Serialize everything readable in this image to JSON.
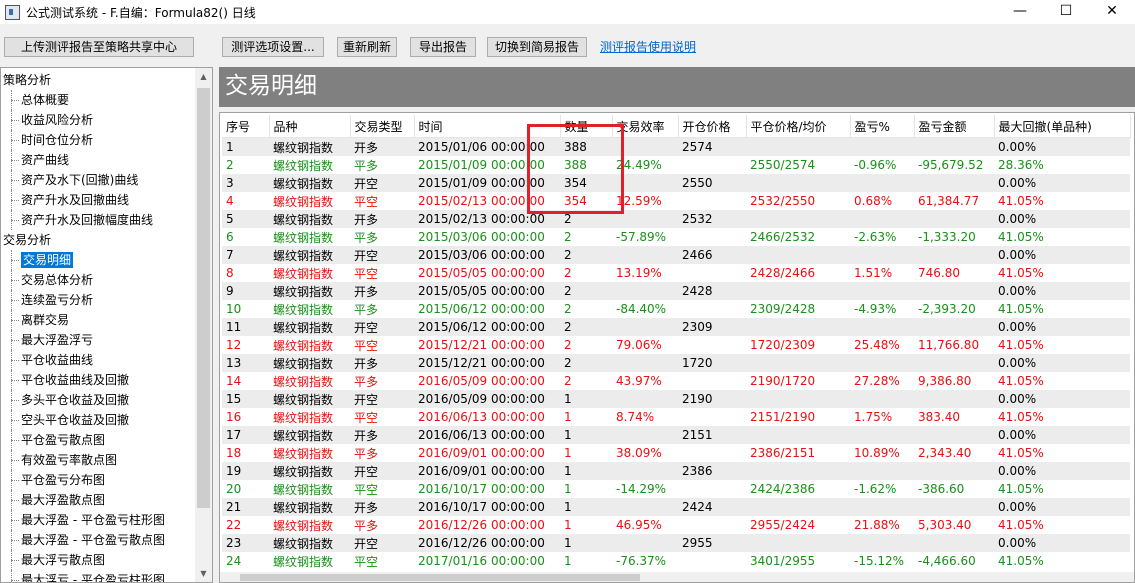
{
  "window": {
    "title": "公式测试系统 - F.自编：Formula82() 日线",
    "minimize": "—",
    "maximize": "☐",
    "close": "✕"
  },
  "toolbar": {
    "upload": "上传测评报告至策略共享中心",
    "options": "测评选项设置...",
    "refresh": "重新刷新",
    "export": "导出报告",
    "switch": "切换到简易报告",
    "help_link": "测评报告使用说明"
  },
  "sidebar": {
    "items": [
      {
        "label": "策略分析",
        "level": 0
      },
      {
        "label": "总体概要",
        "level": 1
      },
      {
        "label": "收益风险分析",
        "level": 1
      },
      {
        "label": "时间仓位分析",
        "level": 1
      },
      {
        "label": "资产曲线",
        "level": 1
      },
      {
        "label": "资产及水下(回撤)曲线",
        "level": 1
      },
      {
        "label": "资产升水及回撤曲线",
        "level": 1
      },
      {
        "label": "资产升水及回撤幅度曲线",
        "level": 1
      },
      {
        "label": "交易分析",
        "level": 0
      },
      {
        "label": "交易明细",
        "level": 1,
        "selected": true
      },
      {
        "label": "交易总体分析",
        "level": 1
      },
      {
        "label": "连续盈亏分析",
        "level": 1
      },
      {
        "label": "离群交易",
        "level": 1
      },
      {
        "label": "最大浮盈浮亏",
        "level": 1
      },
      {
        "label": "平仓收益曲线",
        "level": 1
      },
      {
        "label": "平仓收益曲线及回撤",
        "level": 1
      },
      {
        "label": "多头平仓收益及回撤",
        "level": 1
      },
      {
        "label": "空头平仓收益及回撤",
        "level": 1
      },
      {
        "label": "平仓盈亏散点图",
        "level": 1
      },
      {
        "label": "有效盈亏率散点图",
        "level": 1
      },
      {
        "label": "平仓盈亏分布图",
        "level": 1
      },
      {
        "label": "最大浮盈散点图",
        "level": 1
      },
      {
        "label": "最大浮盈 - 平仓盈亏柱形图",
        "level": 1
      },
      {
        "label": "最大浮盈 - 平仓盈亏散点图",
        "level": 1
      },
      {
        "label": "最大浮亏散点图",
        "level": 1
      },
      {
        "label": "最大浮亏 - 平仓盈亏柱形图",
        "level": 1
      }
    ]
  },
  "main": {
    "heading": "交易明细",
    "columns": [
      "序号",
      "品种",
      "交易类型",
      "时间",
      "数量",
      "交易效率",
      "开仓价格",
      "平仓价格/均价",
      "盈亏%",
      "盈亏金额",
      "最大回撤(单品种)"
    ],
    "rows": [
      {
        "color": "black",
        "cells": [
          "1",
          "螺纹钢指数",
          "开多",
          "2015/01/06 00:00:00",
          "388",
          "",
          "2574",
          "",
          "",
          "",
          "0.00%"
        ]
      },
      {
        "color": "green",
        "cells": [
          "2",
          "螺纹钢指数",
          "平多",
          "2015/01/09 00:00:00",
          "388",
          "24.49%",
          "",
          "2550/2574",
          "-0.96%",
          "-95,679.52",
          "28.36%"
        ]
      },
      {
        "color": "black",
        "cells": [
          "3",
          "螺纹钢指数",
          "开空",
          "2015/01/09 00:00:00",
          "354",
          "",
          "2550",
          "",
          "",
          "",
          "0.00%"
        ]
      },
      {
        "color": "red",
        "cells": [
          "4",
          "螺纹钢指数",
          "平空",
          "2015/02/13 00:00:00",
          "354",
          "12.59%",
          "",
          "2532/2550",
          "0.68%",
          "61,384.77",
          "41.05%"
        ]
      },
      {
        "color": "black",
        "cells": [
          "5",
          "螺纹钢指数",
          "开多",
          "2015/02/13 00:00:00",
          "2",
          "",
          "2532",
          "",
          "",
          "",
          "0.00%"
        ]
      },
      {
        "color": "green",
        "cells": [
          "6",
          "螺纹钢指数",
          "平多",
          "2015/03/06 00:00:00",
          "2",
          "-57.89%",
          "",
          "2466/2532",
          "-2.63%",
          "-1,333.20",
          "41.05%"
        ]
      },
      {
        "color": "black",
        "cells": [
          "7",
          "螺纹钢指数",
          "开空",
          "2015/03/06 00:00:00",
          "2",
          "",
          "2466",
          "",
          "",
          "",
          "0.00%"
        ]
      },
      {
        "color": "red",
        "cells": [
          "8",
          "螺纹钢指数",
          "平空",
          "2015/05/05 00:00:00",
          "2",
          "13.19%",
          "",
          "2428/2466",
          "1.51%",
          "746.80",
          "41.05%"
        ]
      },
      {
        "color": "black",
        "cells": [
          "9",
          "螺纹钢指数",
          "开多",
          "2015/05/05 00:00:00",
          "2",
          "",
          "2428",
          "",
          "",
          "",
          "0.00%"
        ]
      },
      {
        "color": "green",
        "cells": [
          "10",
          "螺纹钢指数",
          "平多",
          "2015/06/12 00:00:00",
          "2",
          "-84.40%",
          "",
          "2309/2428",
          "-4.93%",
          "-2,393.20",
          "41.05%"
        ]
      },
      {
        "color": "black",
        "cells": [
          "11",
          "螺纹钢指数",
          "开空",
          "2015/06/12 00:00:00",
          "2",
          "",
          "2309",
          "",
          "",
          "",
          "0.00%"
        ]
      },
      {
        "color": "red",
        "cells": [
          "12",
          "螺纹钢指数",
          "平空",
          "2015/12/21 00:00:00",
          "2",
          "79.06%",
          "",
          "1720/2309",
          "25.48%",
          "11,766.80",
          "41.05%"
        ]
      },
      {
        "color": "black",
        "cells": [
          "13",
          "螺纹钢指数",
          "开多",
          "2015/12/21 00:00:00",
          "2",
          "",
          "1720",
          "",
          "",
          "",
          "0.00%"
        ]
      },
      {
        "color": "red",
        "cells": [
          "14",
          "螺纹钢指数",
          "平多",
          "2016/05/09 00:00:00",
          "2",
          "43.97%",
          "",
          "2190/1720",
          "27.28%",
          "9,386.80",
          "41.05%"
        ]
      },
      {
        "color": "black",
        "cells": [
          "15",
          "螺纹钢指数",
          "开空",
          "2016/05/09 00:00:00",
          "1",
          "",
          "2190",
          "",
          "",
          "",
          "0.00%"
        ]
      },
      {
        "color": "red",
        "cells": [
          "16",
          "螺纹钢指数",
          "平空",
          "2016/06/13 00:00:00",
          "1",
          "8.74%",
          "",
          "2151/2190",
          "1.75%",
          "383.40",
          "41.05%"
        ]
      },
      {
        "color": "black",
        "cells": [
          "17",
          "螺纹钢指数",
          "开多",
          "2016/06/13 00:00:00",
          "1",
          "",
          "2151",
          "",
          "",
          "",
          "0.00%"
        ]
      },
      {
        "color": "red",
        "cells": [
          "18",
          "螺纹钢指数",
          "平多",
          "2016/09/01 00:00:00",
          "1",
          "38.09%",
          "",
          "2386/2151",
          "10.89%",
          "2,343.40",
          "41.05%"
        ]
      },
      {
        "color": "black",
        "cells": [
          "19",
          "螺纹钢指数",
          "开空",
          "2016/09/01 00:00:00",
          "1",
          "",
          "2386",
          "",
          "",
          "",
          "0.00%"
        ]
      },
      {
        "color": "green",
        "cells": [
          "20",
          "螺纹钢指数",
          "平空",
          "2016/10/17 00:00:00",
          "1",
          "-14.29%",
          "",
          "2424/2386",
          "-1.62%",
          "-386.60",
          "41.05%"
        ]
      },
      {
        "color": "black",
        "cells": [
          "21",
          "螺纹钢指数",
          "开多",
          "2016/10/17 00:00:00",
          "1",
          "",
          "2424",
          "",
          "",
          "",
          "0.00%"
        ]
      },
      {
        "color": "red",
        "cells": [
          "22",
          "螺纹钢指数",
          "平多",
          "2016/12/26 00:00:00",
          "1",
          "46.95%",
          "",
          "2955/2424",
          "21.88%",
          "5,303.40",
          "41.05%"
        ]
      },
      {
        "color": "black",
        "cells": [
          "23",
          "螺纹钢指数",
          "开空",
          "2016/12/26 00:00:00",
          "1",
          "",
          "2955",
          "",
          "",
          "",
          "0.00%"
        ]
      },
      {
        "color": "green",
        "cells": [
          "24",
          "螺纹钢指数",
          "平空",
          "2017/01/16 00:00:00",
          "1",
          "-76.37%",
          "",
          "3401/2955",
          "-15.12%",
          "-4,466.60",
          "41.05%"
        ]
      }
    ]
  },
  "colors": {
    "header_bg": "#808080",
    "profit_red": "#e81010",
    "loss_green": "#1a8f1a",
    "selection_blue": "#0078d7",
    "annotation_box": "#e0202a"
  }
}
